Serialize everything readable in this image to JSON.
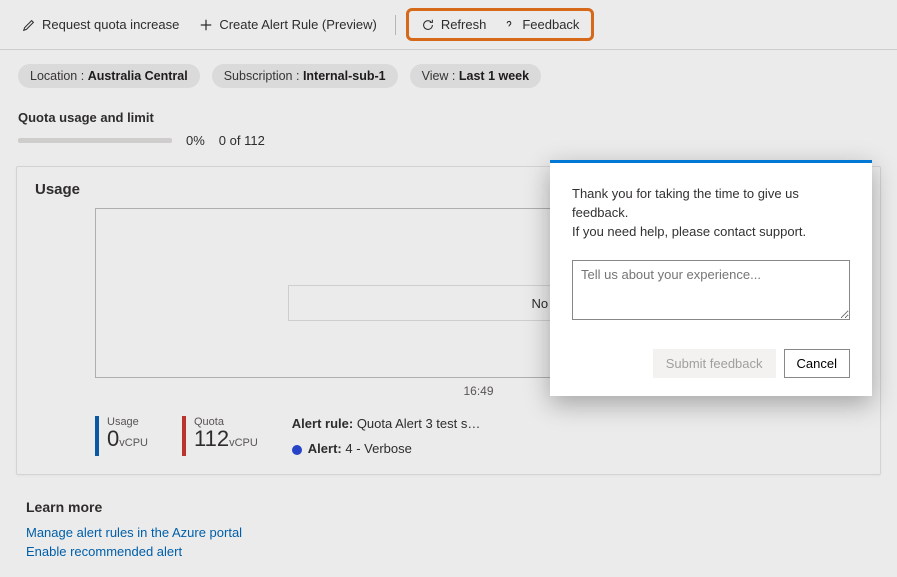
{
  "toolbar": {
    "request_quota": "Request quota increase",
    "create_alert": "Create Alert Rule (Preview)",
    "refresh": "Refresh",
    "feedback": "Feedback"
  },
  "filters": {
    "location_key": "Location : ",
    "location_val": "Australia Central",
    "subscription_key": "Subscription : ",
    "subscription_val": "Internal-sub-1",
    "view_key": "View : ",
    "view_val": "Last 1 week"
  },
  "quota": {
    "title": "Quota usage and limit",
    "pct": "0%",
    "of_text": "0 of 112"
  },
  "card": {
    "title": "Usage",
    "no_alerts": "No Fired Alerts",
    "x_label": "16:49",
    "legend": {
      "usage_label": "Usage",
      "usage_value": "0",
      "usage_unit": "vCPU",
      "quota_label": "Quota",
      "quota_value": "112",
      "quota_unit": "vCPU"
    },
    "alert_rule_label": "Alert rule:",
    "alert_rule_value": " Quota Alert 3 test s…",
    "alert_label": "Alert:",
    "alert_value": " 4 - Verbose"
  },
  "learn": {
    "title": "Learn more",
    "link1": "Manage alert rules in the Azure portal",
    "link2": "Enable recommended alert"
  },
  "modal": {
    "line1": "Thank you for taking the time to give us feedback.",
    "line2": "If you need help, please contact support.",
    "placeholder": "Tell us about your experience...",
    "submit": "Submit feedback",
    "cancel": "Cancel"
  }
}
